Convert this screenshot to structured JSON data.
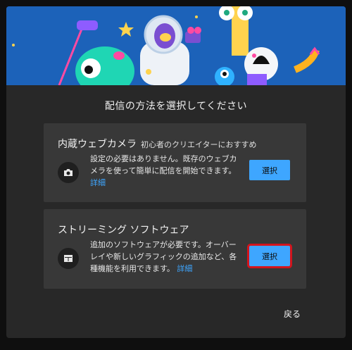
{
  "dialog": {
    "title": "配信の方法を選択してください",
    "back_label": "戻る"
  },
  "options": [
    {
      "title": "内蔵ウェブカメラ",
      "subtitle": "初心者のクリエイターにおすすめ",
      "description": "設定の必要はありません。既存のウェブカメラを使って簡単に配信を開始できます。",
      "link": "詳細",
      "button": "選択",
      "icon": "camera-icon"
    },
    {
      "title": "ストリーミング ソフトウェア",
      "subtitle": "",
      "description": "追加のソフトウェアが必要です。オーバーレイや新しいグラフィックの追加など、各種機能を利用できます。",
      "link": "詳細",
      "button": "選択",
      "icon": "software-window-icon"
    }
  ],
  "colors": {
    "accent": "#3ea6ff",
    "highlight": "#d3141c",
    "card": "#383838",
    "dialog": "#282828"
  }
}
